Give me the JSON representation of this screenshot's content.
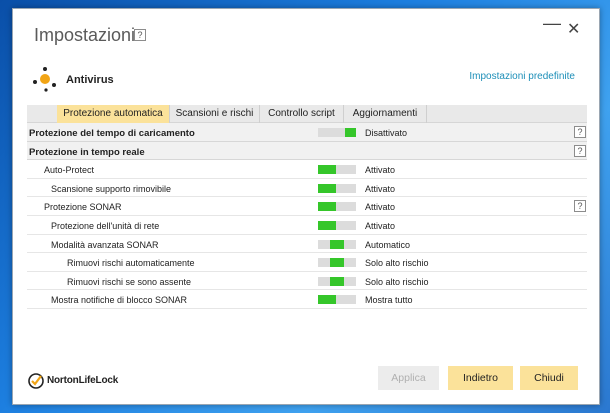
{
  "window": {
    "title": "Impostazioni",
    "help": "?",
    "minimize": "—",
    "close": "✕"
  },
  "product": {
    "name": "Antivirus",
    "icon": "antivirus-dots-icon",
    "defaults_link": "Impostazioni predefinite"
  },
  "tabs": [
    {
      "label": "Protezione automatica",
      "active": true
    },
    {
      "label": "Scansioni e rischi",
      "active": false
    },
    {
      "label": "Controllo script",
      "active": false
    },
    {
      "label": "Aggiornamenti",
      "active": false
    }
  ],
  "rows": [
    {
      "label": "Protezione del tempo di caricamento",
      "status": "Disattivato",
      "toggle": "off",
      "help": "?"
    },
    {
      "label": "Protezione in tempo reale",
      "help": "?"
    },
    {
      "label": "Auto-Protect",
      "status": "Attivato",
      "toggle": "on"
    },
    {
      "label": "Scansione supporto rimovibile",
      "status": "Attivato",
      "toggle": "on"
    },
    {
      "label": "Protezione SONAR",
      "status": "Attivato",
      "toggle": "on",
      "help": "?"
    },
    {
      "label": "Protezione dell'unità di rete",
      "status": "Attivato",
      "toggle": "on"
    },
    {
      "label": "Modalità avanzata SONAR",
      "status": "Automatico",
      "toggle": "mid"
    },
    {
      "label": "Rimuovi rischi automaticamente",
      "status": "Solo alto rischio",
      "toggle": "mid"
    },
    {
      "label": "Rimuovi rischi se sono assente",
      "status": "Solo alto rischio",
      "toggle": "mid"
    },
    {
      "label": "Mostra notifiche di blocco SONAR",
      "status": "Mostra tutto",
      "toggle": "on"
    }
  ],
  "footer": {
    "brand": "NortonLifeLock",
    "apply": "Applica",
    "back": "Indietro",
    "close": "Chiudi"
  },
  "colors": {
    "accent": "#fbe29a",
    "toggle_on": "#35c62a",
    "link": "#1d8fb8"
  }
}
